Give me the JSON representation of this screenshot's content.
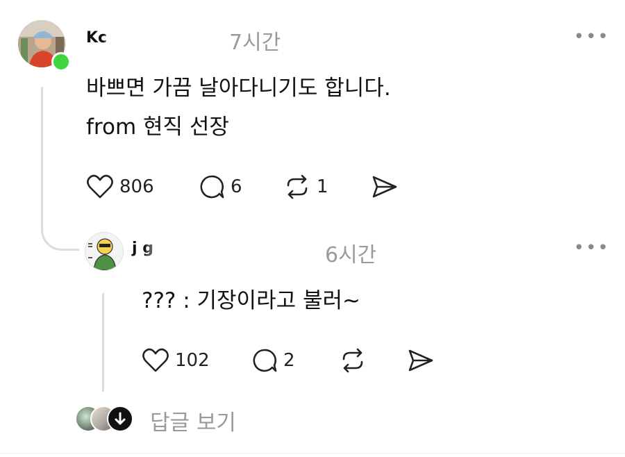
{
  "colors": {
    "online": "#3fd53f",
    "muted": "#9a9a9a",
    "thread_line": "#dcdcdc"
  },
  "post": {
    "username": "Kc",
    "time": "7시간",
    "more_icon": "ellipsis-icon",
    "lines": [
      "바쁘면 가끔 날아다니기도 합니다.",
      "from 현직 선장"
    ],
    "likes": "806",
    "comments": "6",
    "reposts": "1"
  },
  "reply": {
    "username": "j g",
    "time": "6시간",
    "more_icon": "ellipsis-icon",
    "text": "??? : 기장이라고 불러~",
    "likes": "102",
    "comments": "2"
  },
  "footer": {
    "view_replies_label": "답글 보기"
  }
}
